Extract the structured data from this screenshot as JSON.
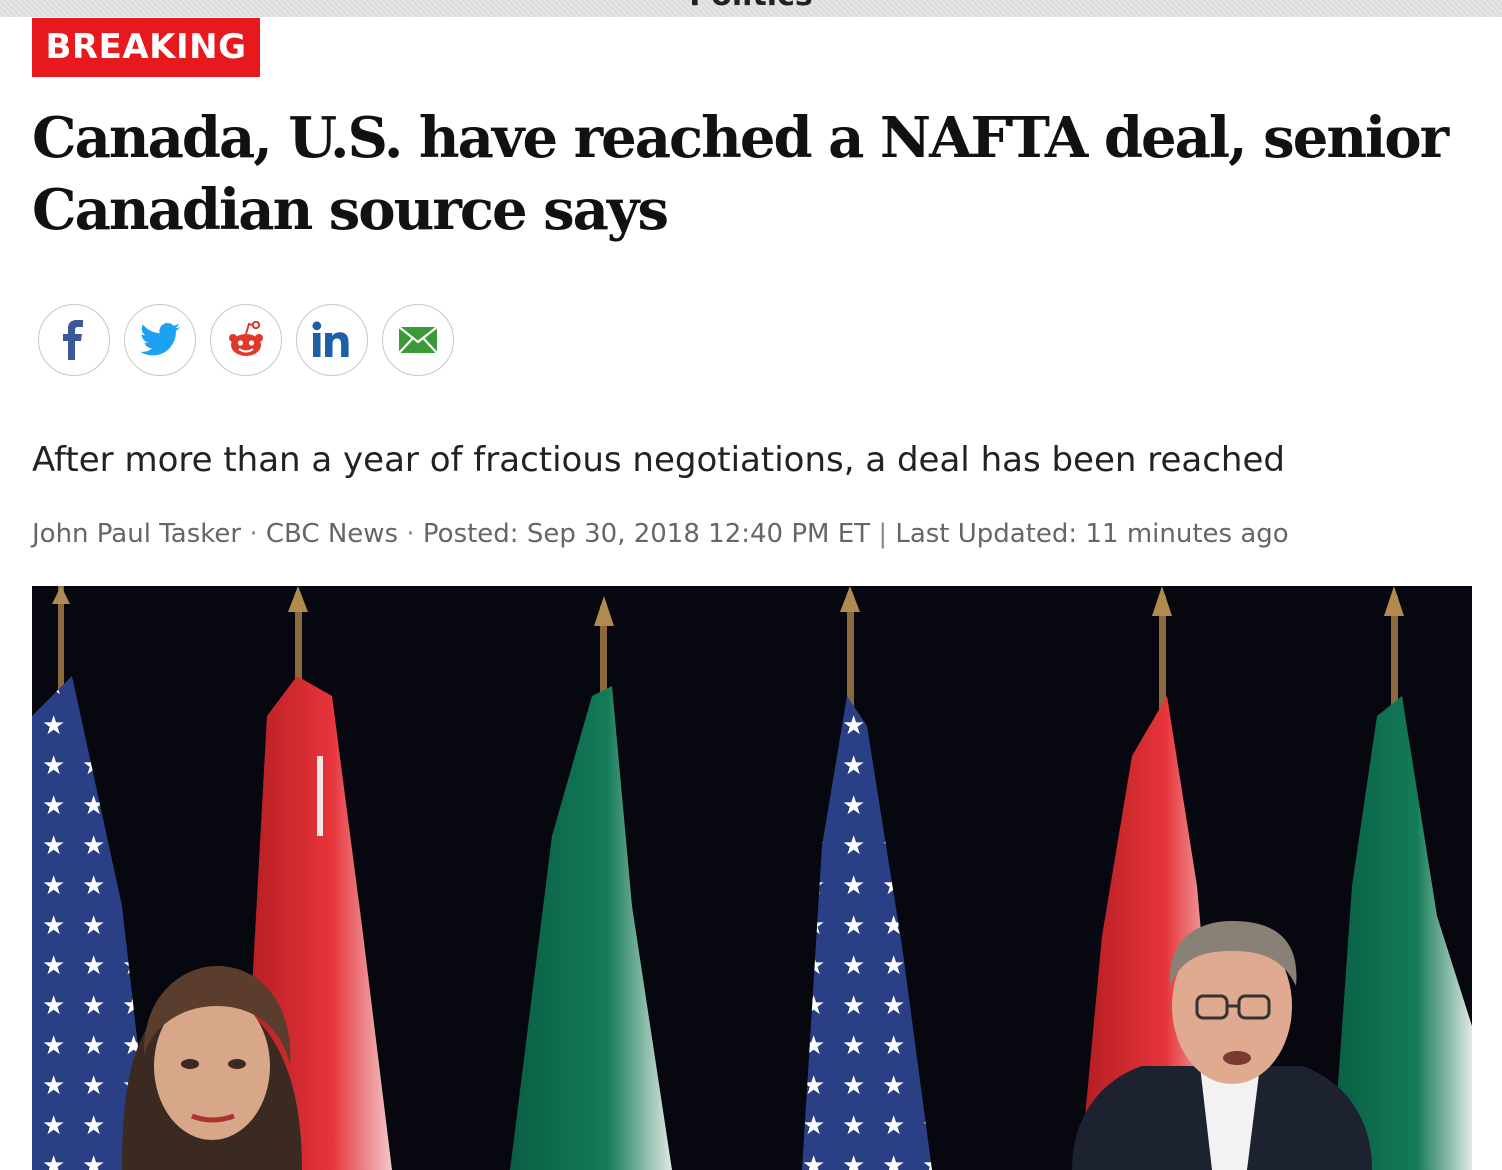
{
  "section": {
    "label": "Politics"
  },
  "badge": {
    "label": "BREAKING",
    "color": "#e8191d"
  },
  "headline": {
    "text": "Canada, U.S. have reached a NAFTA deal, senior Canadian source says"
  },
  "share": {
    "buttons": [
      {
        "icon": "facebook-icon"
      },
      {
        "icon": "twitter-icon"
      },
      {
        "icon": "reddit-icon"
      },
      {
        "icon": "linkedin-icon"
      },
      {
        "icon": "email-icon"
      }
    ]
  },
  "dek": {
    "text": "After more than a year of fractious negotiations, a deal has been reached"
  },
  "byline": {
    "author": "John Paul Tasker",
    "outlet": "CBC News",
    "posted_label": "Posted:",
    "posted": "Sep 30, 2018 12:40 PM ET",
    "updated_label": "Last Updated:",
    "updated": "11 minutes ago"
  },
  "colors": {
    "facebook": "#3b5998",
    "twitter": "#1da1f2",
    "reddit": "#e0392c",
    "linkedin": "#1b5fa6",
    "email": "#3a9a3a"
  }
}
